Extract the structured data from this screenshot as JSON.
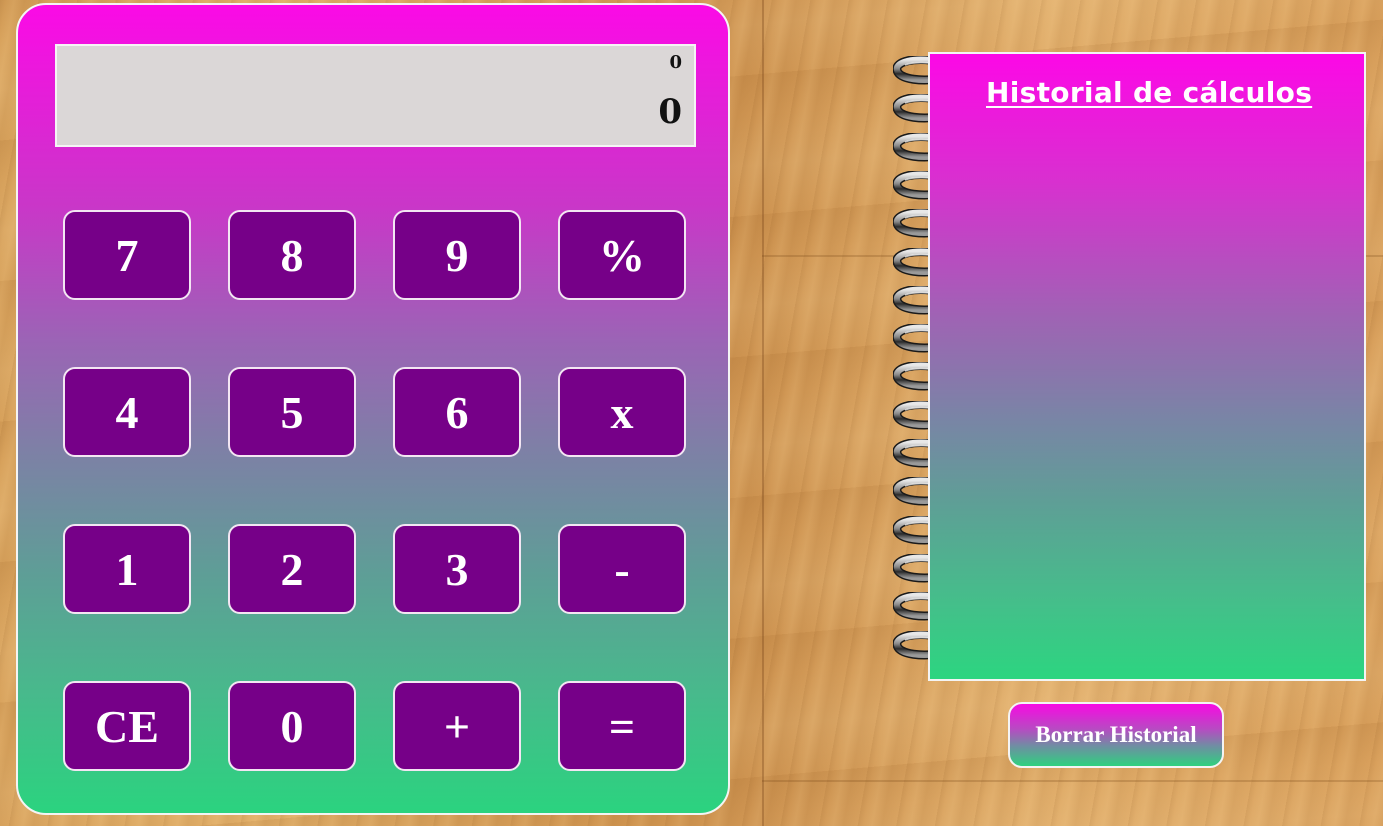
{
  "calculator": {
    "display": {
      "expression": "0",
      "result": "0"
    },
    "keys": [
      {
        "label": "7",
        "name": "key-7-button"
      },
      {
        "label": "8",
        "name": "key-8-button"
      },
      {
        "label": "9",
        "name": "key-9-button"
      },
      {
        "label": "%",
        "name": "percent-button"
      },
      {
        "label": "4",
        "name": "key-4-button"
      },
      {
        "label": "5",
        "name": "key-5-button"
      },
      {
        "label": "6",
        "name": "key-6-button"
      },
      {
        "label": "x",
        "name": "multiply-button"
      },
      {
        "label": "1",
        "name": "key-1-button"
      },
      {
        "label": "2",
        "name": "key-2-button"
      },
      {
        "label": "3",
        "name": "key-3-button"
      },
      {
        "label": "-",
        "name": "subtract-button"
      },
      {
        "label": "CE",
        "name": "clear-entry-button"
      },
      {
        "label": "0",
        "name": "key-0-button"
      },
      {
        "label": "+",
        "name": "add-button"
      },
      {
        "label": "=",
        "name": "equals-button"
      }
    ],
    "colors": {
      "key_background": "#760088",
      "gradient_top": "#fb0ae6",
      "gradient_bottom": "#2bd37f",
      "display_background": "#dbd7d7"
    }
  },
  "history": {
    "title": "Historial de cálculos",
    "entries": [],
    "clear_label": "Borrar Historial",
    "ring_icon": "spiral-binding-ring-icon",
    "ring_count": 16
  }
}
